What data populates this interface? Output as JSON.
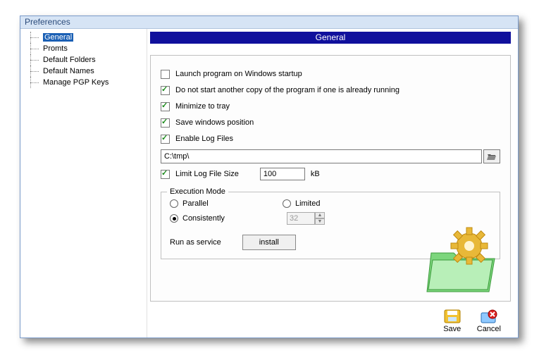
{
  "window": {
    "title": "Preferences"
  },
  "tree": {
    "items": [
      {
        "label": "General",
        "selected": true
      },
      {
        "label": "Promts"
      },
      {
        "label": "Default Folders"
      },
      {
        "label": "Default Names"
      },
      {
        "label": "Manage PGP Keys"
      }
    ]
  },
  "panel": {
    "header": "General",
    "options": {
      "launch_startup": {
        "label": "Launch program on Windows startup",
        "checked": false
      },
      "no_duplicate": {
        "label": "Do not start another copy of the program if one is already running",
        "checked": true
      },
      "minimize_tray": {
        "label": "Minimize to tray",
        "checked": true
      },
      "save_pos": {
        "label": "Save windows position",
        "checked": true
      },
      "enable_log": {
        "label": "Enable Log Files",
        "checked": true
      }
    },
    "log_path": "C:\\tmp\\",
    "limit_log": {
      "label": "Limit Log File Size",
      "checked": true,
      "value": "100",
      "unit": "kB"
    },
    "execution": {
      "legend": "Execution Mode",
      "parallel": "Parallel",
      "limited": "Limited",
      "consistently": "Consistently",
      "selected": "consistently",
      "limit_value": "32"
    },
    "service": {
      "label": "Run as service",
      "button": "install"
    }
  },
  "footer": {
    "save": "Save",
    "cancel": "Cancel"
  }
}
